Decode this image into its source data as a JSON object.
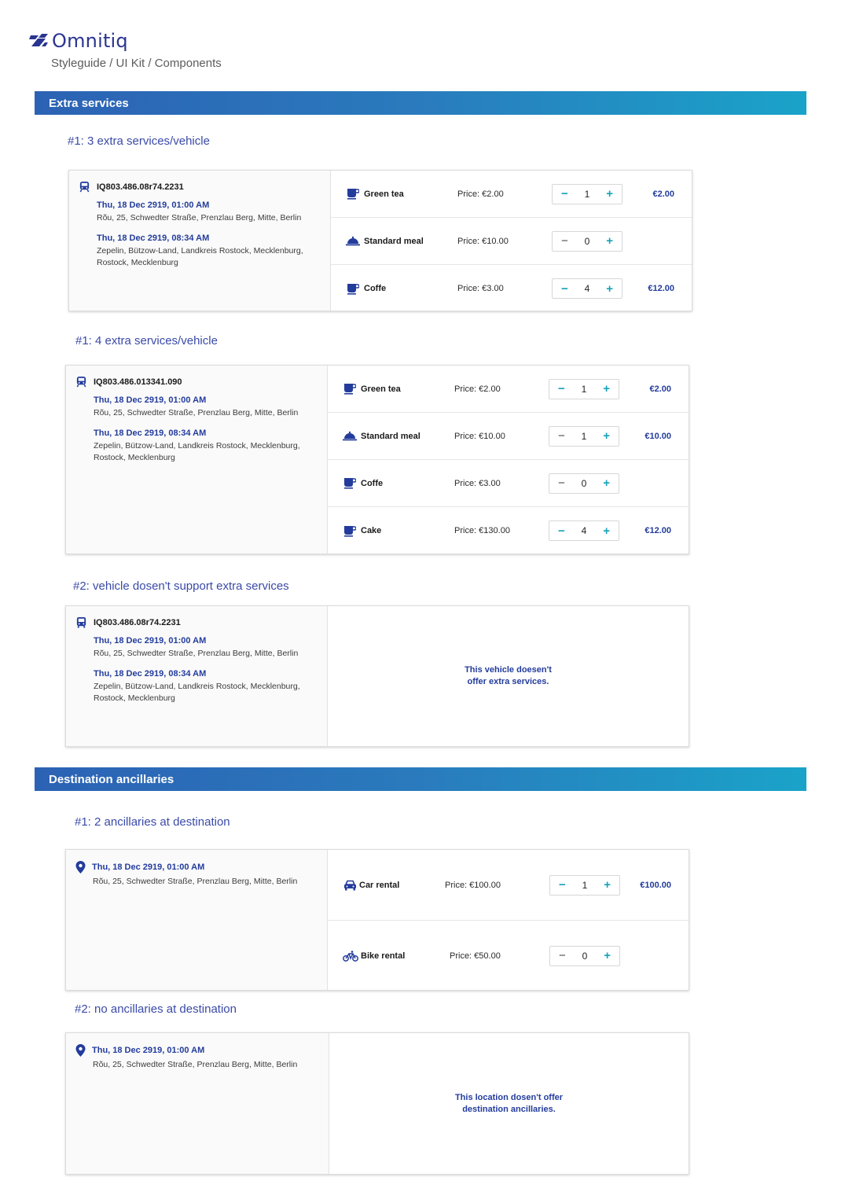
{
  "brand": {
    "name": "Omnitiq",
    "color": "#2a3590"
  },
  "breadcrumb": "Styleguide / UI Kit / Components",
  "colors": {
    "accent": "#16a3b8",
    "primary": "#233c9c",
    "bar_start": "#2c62b4",
    "bar_end": "#1aa3c9"
  },
  "sections": {
    "extra": {
      "title": "Extra services"
    },
    "dest": {
      "title": "Destination ancillaries"
    }
  },
  "cards": {
    "c1": {
      "title": "#1: 3 extra services/vehicle",
      "vehicle_icon": "train-icon",
      "vehicle_id": "IQ803.486.08r74.2231",
      "dep_time": "Thu, 18 Dec 2919, 01:00 AM",
      "dep_addr": "Rõu, 25, Schwedter Straße, Prenzlau Berg, Mitte, Berlin",
      "arr_time": "Thu, 18 Dec 2919, 08:34 AM",
      "arr_addr": "Zepelin, Bützow-Land, Landkreis Rostock, Mecklenburg, Rostock, Mecklenburg",
      "services": [
        {
          "icon": "cup-icon",
          "name": "Green tea",
          "price": "Price:  €2.00",
          "qty": "1",
          "total": "€2.00"
        },
        {
          "icon": "meal-cloche-icon",
          "name": "Standard meal",
          "price": "Price:  €10.00",
          "qty": "0",
          "total": ""
        },
        {
          "icon": "cup-icon",
          "name": "Coffe",
          "price": "Price:  €3.00",
          "qty": "4",
          "total": "€12.00"
        }
      ]
    },
    "c2": {
      "title": "#1: 4 extra services/vehicle",
      "vehicle_icon": "train-icon",
      "vehicle_id": "IQ803.486.013341.090",
      "dep_time": "Thu, 18 Dec 2919, 01:00 AM",
      "dep_addr": "Rõu, 25, Schwedter Straße, Prenzlau Berg, Mitte, Berlin",
      "arr_time": "Thu, 18 Dec 2919, 08:34 AM",
      "arr_addr": "Zepelin, Bützow-Land, Landkreis Rostock, Mecklenburg, Rostock, Mecklenburg",
      "services": [
        {
          "icon": "cup-icon",
          "name": "Green tea",
          "price": "Price:  €2.00",
          "qty": "1",
          "total": "€2.00"
        },
        {
          "icon": "meal-cloche-icon",
          "name": "Standard meal",
          "price": "Price:  €10.00",
          "qty": "1",
          "total": "€10.00"
        },
        {
          "icon": "cup-icon",
          "name": "Coffe",
          "price": "Price:  €3.00",
          "qty": "0",
          "total": ""
        },
        {
          "icon": "cup-icon",
          "name": "Cake",
          "price": "Price:  €130.00",
          "qty": "4",
          "total": "€12.00"
        }
      ]
    },
    "c3": {
      "title": "#2: vehicle dosen't support extra services",
      "vehicle_icon": "bus-icon",
      "vehicle_id": "IQ803.486.08r74.2231",
      "dep_time": "Thu, 18 Dec 2919, 01:00 AM",
      "dep_addr": "Rõu, 25, Schwedter Straße, Prenzlau Berg, Mitte, Berlin",
      "arr_time": "Thu, 18 Dec 2919, 08:34 AM",
      "arr_addr": "Zepelin, Bützow-Land, Landkreis Rostock, Mecklenburg, Rostock, Mecklenburg",
      "empty_line1": "This vehicle doesen't",
      "empty_line2": "offer extra services."
    },
    "c4": {
      "title": "#1: 2 ancillaries at destination",
      "time": "Thu, 18 Dec 2919, 01:00 AM",
      "addr": "Rõu, 25, Schwedter Straße, Prenzlau Berg, Mitte, Berlin",
      "services": [
        {
          "icon": "car-icon",
          "name": "Car rental",
          "price": "Price:  €100.00",
          "qty": "1",
          "total": "€100.00"
        },
        {
          "icon": "bike-icon",
          "name": "Bike rental",
          "price": "Price:  €50.00",
          "qty": "0",
          "total": ""
        }
      ]
    },
    "c5": {
      "title": "#2: no ancillaries at destination",
      "time": "Thu, 18 Dec 2919, 01:00 AM",
      "addr": "Rõu, 25, Schwedter Straße, Prenzlau Berg, Mitte, Berlin",
      "empty_line1": "This location dosen't offer",
      "empty_line2": "destination ancillaries."
    }
  }
}
